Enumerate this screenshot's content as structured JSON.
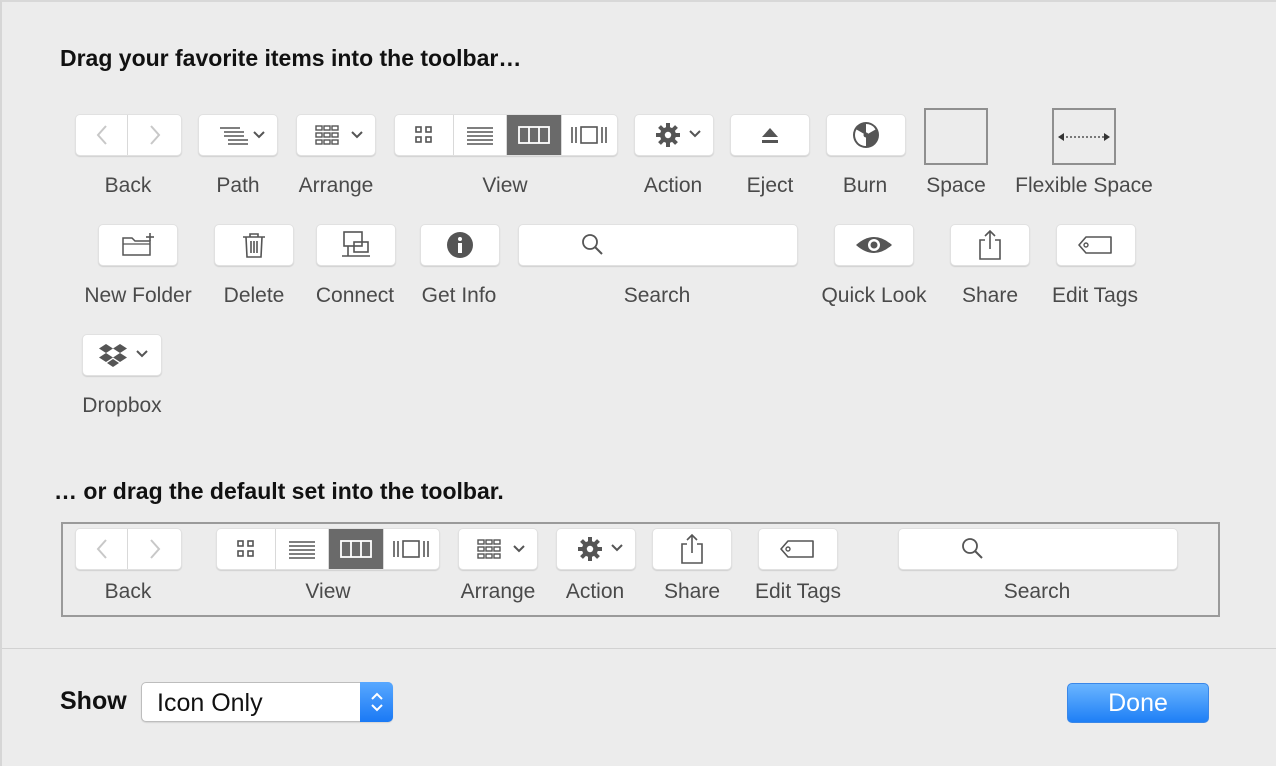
{
  "dialog": {
    "favorites_heading": "Drag your favorite items into the toolbar…",
    "default_heading": "… or drag the default set into the toolbar.",
    "favorites": {
      "back": "Back",
      "path": "Path",
      "arrange": "Arrange",
      "view": "View",
      "action": "Action",
      "eject": "Eject",
      "burn": "Burn",
      "space": "Space",
      "flexible_space": "Flexible Space",
      "new_folder": "New Folder",
      "delete": "Delete",
      "connect": "Connect",
      "get_info": "Get Info",
      "search": "Search",
      "quick_look": "Quick Look",
      "share": "Share",
      "edit_tags": "Edit Tags",
      "dropbox": "Dropbox"
    },
    "default_set": {
      "back": "Back",
      "view": "View",
      "arrange": "Arrange",
      "action": "Action",
      "share": "Share",
      "edit_tags": "Edit Tags",
      "search": "Search"
    },
    "show_label": "Show",
    "show_value": "Icon Only",
    "done_label": "Done"
  },
  "colors": {
    "selected_segment": "#6a6a6a",
    "done_button": "#1e7ff6",
    "background": "#ececec"
  },
  "icons": [
    "chevron-left-icon",
    "chevron-right-icon",
    "path-icon",
    "arrange-icon",
    "icon-view-icon",
    "list-view-icon",
    "column-view-icon",
    "cover-flow-icon",
    "gear-icon",
    "eject-icon",
    "burn-icon",
    "new-folder-icon",
    "trash-icon",
    "connect-icon",
    "info-icon",
    "search-icon",
    "eye-icon",
    "share-icon",
    "tag-icon",
    "dropbox-icon"
  ]
}
